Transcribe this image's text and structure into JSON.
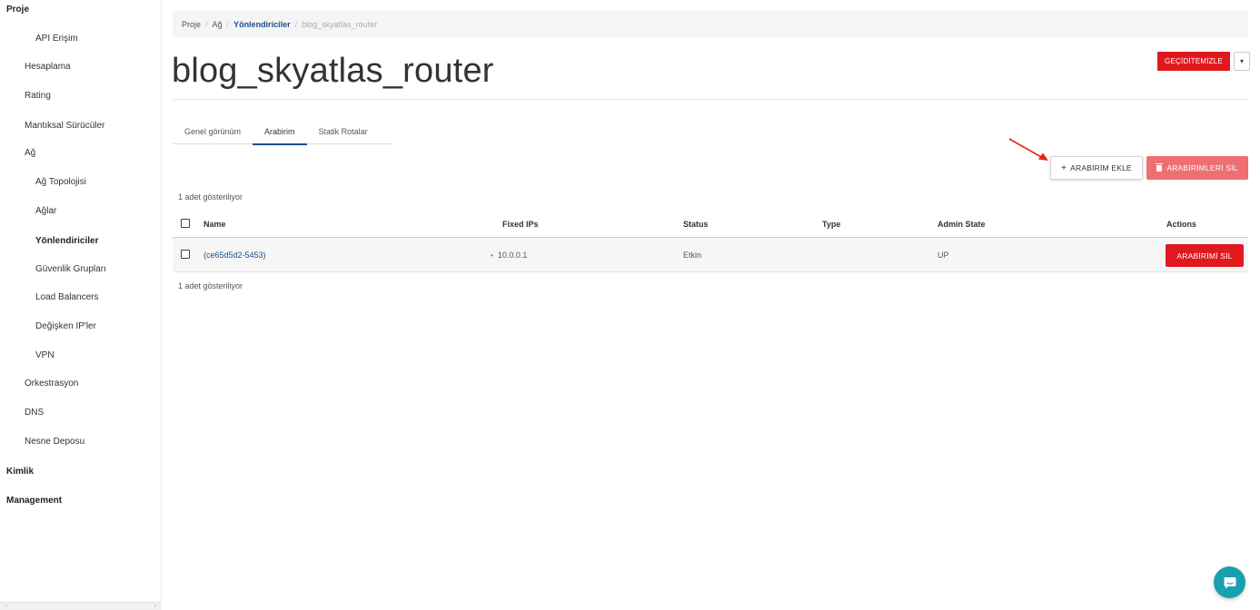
{
  "sidebar": {
    "items": [
      {
        "label": "Proje"
      },
      {
        "label": "API Erişim"
      },
      {
        "label": "Hesaplama"
      },
      {
        "label": "Rating"
      },
      {
        "label": "Mantıksal Sürücüler"
      },
      {
        "label": "Ağ"
      },
      {
        "label": "Ağ Topolojisi"
      },
      {
        "label": "Ağlar"
      },
      {
        "label": "Yönlendiriciler"
      },
      {
        "label": "Güvenlik Grupları"
      },
      {
        "label": "Load Balancers"
      },
      {
        "label": "Değişken IP'ler"
      },
      {
        "label": "VPN"
      },
      {
        "label": "Orkestrasyon"
      },
      {
        "label": "DNS"
      },
      {
        "label": "Nesne Deposu"
      },
      {
        "label": "Kimlik"
      },
      {
        "label": "Management"
      }
    ],
    "scroll_left": "‹",
    "scroll_right": "›"
  },
  "breadcrumb": {
    "items": [
      "Proje",
      "Ağ",
      "Yönlendiriciler",
      "blog_skyatlas_router"
    ],
    "separator": "/"
  },
  "page": {
    "title": "blog_skyatlas_router",
    "gateway_button": "GEÇİDİTEMİZLE",
    "caret": "▾"
  },
  "tabs": [
    {
      "label": "Genel görünüm",
      "active": false
    },
    {
      "label": "Arabirim",
      "active": true
    },
    {
      "label": "Statik Rotalar",
      "active": false
    }
  ],
  "actions": {
    "add_label": "ARABİRİM EKLE",
    "add_icon": "+",
    "delete_all_label": "ARABİRİMLERİ SİL",
    "delete_all_icon": "trash-icon"
  },
  "table": {
    "count_top": "1 adet gösteriliyor",
    "count_bottom": "1 adet gösteriliyor",
    "columns": [
      "Name",
      "Fixed IPs",
      "Status",
      "Type",
      "Admin State",
      "Actions"
    ],
    "rows": [
      {
        "name": "(ce65d5d2-5453)",
        "fixed_ip": "10.0.0.1",
        "status": "Etkin",
        "type": "",
        "admin_state": "UP",
        "action": "ARABİRİMİ SİL"
      }
    ]
  },
  "colors": {
    "primary_red": "#e0191e",
    "light_red": "#ed6f72",
    "link_blue": "#1b4f8a",
    "chat_teal": "#1a9fb0",
    "annotation_arrow": "#e8201c"
  },
  "icons": {
    "chat": "chat-bubble-icon",
    "arrow": "annotation-arrow-icon"
  }
}
